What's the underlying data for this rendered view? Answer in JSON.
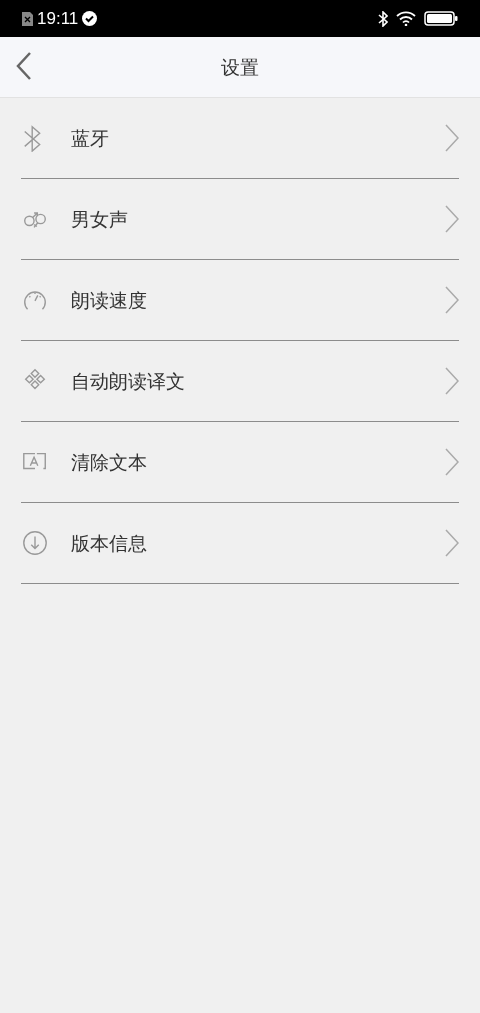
{
  "status_bar": {
    "time": "19:11"
  },
  "header": {
    "title": "设置"
  },
  "items": [
    {
      "kind": "bluetooth",
      "label": "蓝牙"
    },
    {
      "kind": "gender",
      "label": "男女声"
    },
    {
      "kind": "speed",
      "label": "朗读速度"
    },
    {
      "kind": "auto",
      "label": "自动朗读译文"
    },
    {
      "kind": "clear",
      "label": "清除文本"
    },
    {
      "kind": "version",
      "label": "版本信息"
    }
  ]
}
